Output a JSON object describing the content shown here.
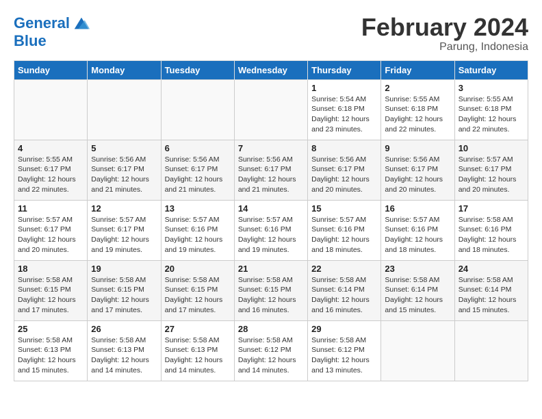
{
  "header": {
    "logo_line1": "General",
    "logo_line2": "Blue",
    "month_title": "February 2024",
    "location": "Parung, Indonesia"
  },
  "days_of_week": [
    "Sunday",
    "Monday",
    "Tuesday",
    "Wednesday",
    "Thursday",
    "Friday",
    "Saturday"
  ],
  "weeks": [
    [
      {
        "day": "",
        "info": ""
      },
      {
        "day": "",
        "info": ""
      },
      {
        "day": "",
        "info": ""
      },
      {
        "day": "",
        "info": ""
      },
      {
        "day": "1",
        "sunrise": "5:54 AM",
        "sunset": "6:18 PM",
        "daylight": "12 hours and 23 minutes."
      },
      {
        "day": "2",
        "sunrise": "5:55 AM",
        "sunset": "6:18 PM",
        "daylight": "12 hours and 22 minutes."
      },
      {
        "day": "3",
        "sunrise": "5:55 AM",
        "sunset": "6:18 PM",
        "daylight": "12 hours and 22 minutes."
      }
    ],
    [
      {
        "day": "4",
        "sunrise": "5:55 AM",
        "sunset": "6:17 PM",
        "daylight": "12 hours and 22 minutes."
      },
      {
        "day": "5",
        "sunrise": "5:56 AM",
        "sunset": "6:17 PM",
        "daylight": "12 hours and 21 minutes."
      },
      {
        "day": "6",
        "sunrise": "5:56 AM",
        "sunset": "6:17 PM",
        "daylight": "12 hours and 21 minutes."
      },
      {
        "day": "7",
        "sunrise": "5:56 AM",
        "sunset": "6:17 PM",
        "daylight": "12 hours and 21 minutes."
      },
      {
        "day": "8",
        "sunrise": "5:56 AM",
        "sunset": "6:17 PM",
        "daylight": "12 hours and 20 minutes."
      },
      {
        "day": "9",
        "sunrise": "5:56 AM",
        "sunset": "6:17 PM",
        "daylight": "12 hours and 20 minutes."
      },
      {
        "day": "10",
        "sunrise": "5:57 AM",
        "sunset": "6:17 PM",
        "daylight": "12 hours and 20 minutes."
      }
    ],
    [
      {
        "day": "11",
        "sunrise": "5:57 AM",
        "sunset": "6:17 PM",
        "daylight": "12 hours and 20 minutes."
      },
      {
        "day": "12",
        "sunrise": "5:57 AM",
        "sunset": "6:17 PM",
        "daylight": "12 hours and 19 minutes."
      },
      {
        "day": "13",
        "sunrise": "5:57 AM",
        "sunset": "6:16 PM",
        "daylight": "12 hours and 19 minutes."
      },
      {
        "day": "14",
        "sunrise": "5:57 AM",
        "sunset": "6:16 PM",
        "daylight": "12 hours and 19 minutes."
      },
      {
        "day": "15",
        "sunrise": "5:57 AM",
        "sunset": "6:16 PM",
        "daylight": "12 hours and 18 minutes."
      },
      {
        "day": "16",
        "sunrise": "5:57 AM",
        "sunset": "6:16 PM",
        "daylight": "12 hours and 18 minutes."
      },
      {
        "day": "17",
        "sunrise": "5:58 AM",
        "sunset": "6:16 PM",
        "daylight": "12 hours and 18 minutes."
      }
    ],
    [
      {
        "day": "18",
        "sunrise": "5:58 AM",
        "sunset": "6:15 PM",
        "daylight": "12 hours and 17 minutes."
      },
      {
        "day": "19",
        "sunrise": "5:58 AM",
        "sunset": "6:15 PM",
        "daylight": "12 hours and 17 minutes."
      },
      {
        "day": "20",
        "sunrise": "5:58 AM",
        "sunset": "6:15 PM",
        "daylight": "12 hours and 17 minutes."
      },
      {
        "day": "21",
        "sunrise": "5:58 AM",
        "sunset": "6:15 PM",
        "daylight": "12 hours and 16 minutes."
      },
      {
        "day": "22",
        "sunrise": "5:58 AM",
        "sunset": "6:14 PM",
        "daylight": "12 hours and 16 minutes."
      },
      {
        "day": "23",
        "sunrise": "5:58 AM",
        "sunset": "6:14 PM",
        "daylight": "12 hours and 15 minutes."
      },
      {
        "day": "24",
        "sunrise": "5:58 AM",
        "sunset": "6:14 PM",
        "daylight": "12 hours and 15 minutes."
      }
    ],
    [
      {
        "day": "25",
        "sunrise": "5:58 AM",
        "sunset": "6:13 PM",
        "daylight": "12 hours and 15 minutes."
      },
      {
        "day": "26",
        "sunrise": "5:58 AM",
        "sunset": "6:13 PM",
        "daylight": "12 hours and 14 minutes."
      },
      {
        "day": "27",
        "sunrise": "5:58 AM",
        "sunset": "6:13 PM",
        "daylight": "12 hours and 14 minutes."
      },
      {
        "day": "28",
        "sunrise": "5:58 AM",
        "sunset": "6:12 PM",
        "daylight": "12 hours and 14 minutes."
      },
      {
        "day": "29",
        "sunrise": "5:58 AM",
        "sunset": "6:12 PM",
        "daylight": "12 hours and 13 minutes."
      },
      {
        "day": "",
        "info": ""
      },
      {
        "day": "",
        "info": ""
      }
    ]
  ]
}
